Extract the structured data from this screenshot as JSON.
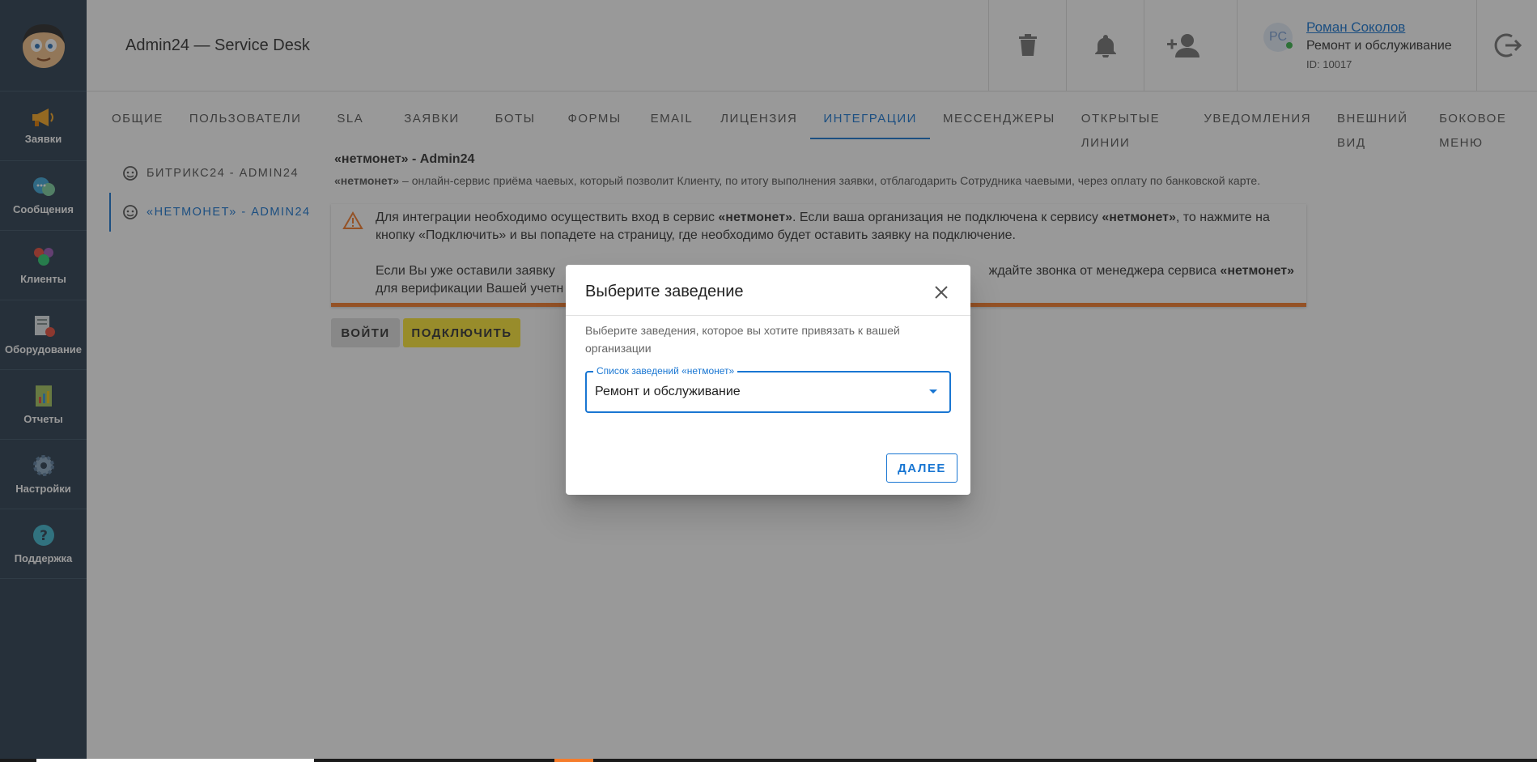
{
  "app": {
    "title": "Admin24 — Service Desk"
  },
  "sidebar": {
    "items": [
      {
        "label": "Заявки",
        "icon": "megaphone-icon"
      },
      {
        "label": "Сообщения",
        "icon": "chat-bubbles-icon"
      },
      {
        "label": "Клиенты",
        "icon": "clients-icon"
      },
      {
        "label": "Оборудование",
        "icon": "equipment-icon"
      },
      {
        "label": "Отчеты",
        "icon": "report-icon"
      },
      {
        "label": "Настройки",
        "icon": "gear-icon"
      },
      {
        "label": "Поддержка",
        "icon": "help-icon"
      }
    ]
  },
  "header": {
    "user": {
      "initials": "РС",
      "name": "Роман Соколов",
      "org": "Ремонт и обслуживание",
      "id": "ID: 10017"
    }
  },
  "tabs": [
    "Общие",
    "Пользователи",
    "SLA",
    "Заявки",
    "Боты",
    "Формы",
    "Email",
    "Лицензия",
    "Интеграции",
    "Мессенджеры",
    "Открытые линии",
    "Уведомления",
    "Внешний вид",
    "Боковое меню"
  ],
  "active_tab": "Интеграции",
  "subnav": [
    {
      "label": "БИТРИКС24 - ADMIN24"
    },
    {
      "label": "«НЕТМОНЕТ» - ADMIN24"
    }
  ],
  "integration": {
    "title": "«нетмонет» - Admin24",
    "desc_bold": "«нетмонет»",
    "desc_rest": " – онлайн-сервис приёма чаевых, который позволит Клиенту, по итогу выполнения заявки, отблагодарить Сотрудника чаевыми, через оплату по банковской карте.",
    "alert": {
      "p1_a": "Для интеграции необходимо осуществить вход в сервис ",
      "p1_b": "«нетмонет»",
      "p1_c": ". Если ваша организация не подключена к сервису ",
      "p1_d": "«нетмонет»",
      "p1_e": ", то нажмите на кнопку «Подключить» и вы попадете на страницу, где необходимо будет оставить заявку на подключение.",
      "p2_a": "Если Вы уже оставили заявку",
      "p2_b": "ждайте звонка от менеджера сервиса ",
      "p2_c": "«нетмонет»",
      "p2_d": "для верификации Вашей учетн"
    },
    "login_label": "ВОЙТИ",
    "connect_label": "ПОДКЛЮЧИТЬ"
  },
  "dialog": {
    "title": "Выберите заведение",
    "subtitle": "Выберите заведения, которое вы хотите привязать к вашей организации",
    "select_label": "Список заведений «нетмонет»",
    "select_value": "Ремонт и обслуживание",
    "next_label": "ДАЛЕЕ"
  }
}
